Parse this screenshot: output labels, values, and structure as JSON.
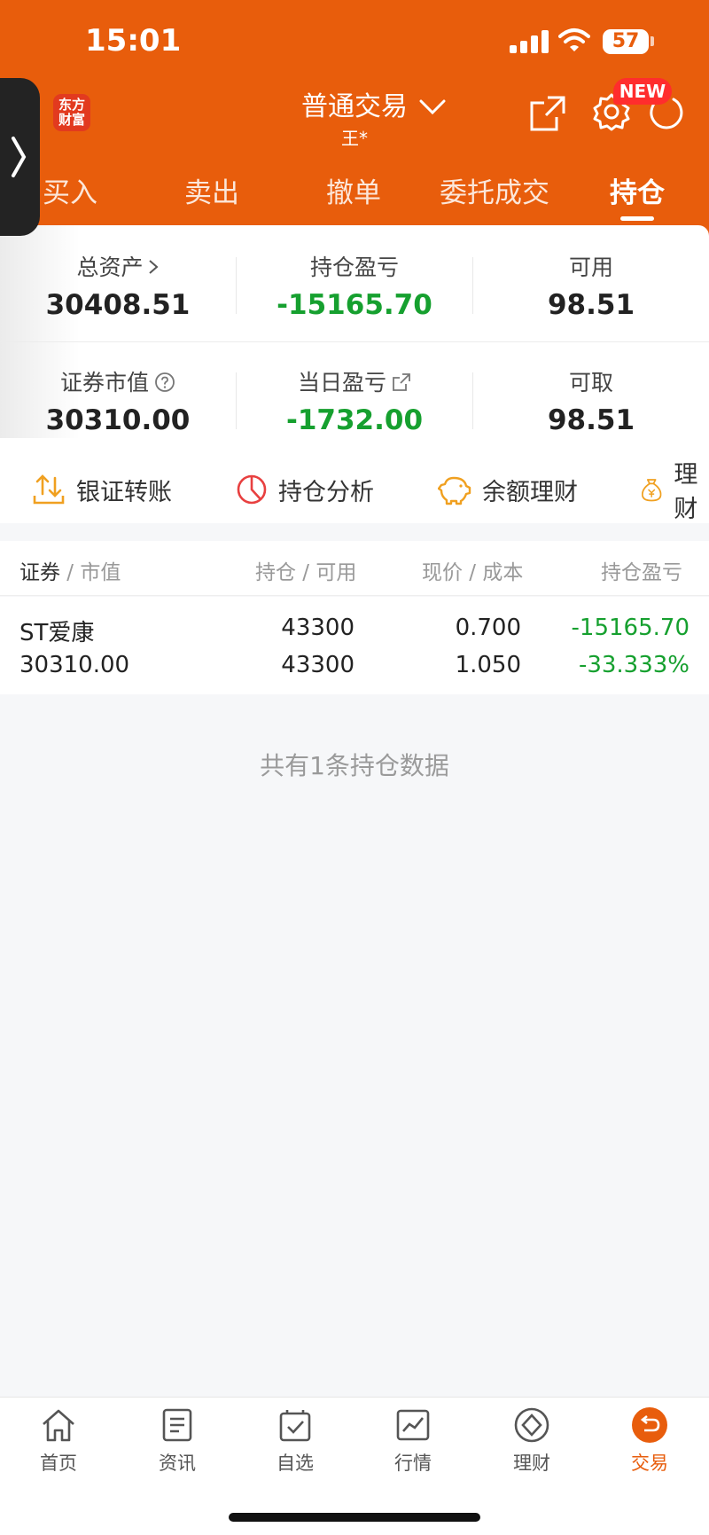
{
  "status_bar": {
    "time": "15:01",
    "battery": "57"
  },
  "header": {
    "logo_text": "东方财富",
    "title": "普通交易",
    "subtitle": "王*",
    "new_badge": "NEW",
    "brand_color": "#e85d0c"
  },
  "tabs": [
    {
      "label": "买入"
    },
    {
      "label": "卖出"
    },
    {
      "label": "撤单"
    },
    {
      "label": "委托成交"
    },
    {
      "label": "持仓",
      "active": true
    }
  ],
  "summary": {
    "total_assets_label": "总资产",
    "total_assets": "30408.51",
    "position_pl_label": "持仓盈亏",
    "position_pl": "-15165.70",
    "available_label": "可用",
    "available": "98.51",
    "market_value_label": "证券市值",
    "market_value": "30310.00",
    "daily_pl_label": "当日盈亏",
    "daily_pl": "-1732.00",
    "withdrawable_label": "可取",
    "withdrawable": "98.51"
  },
  "quick_actions": [
    {
      "label": "银证转账",
      "icon": "transfer-icon"
    },
    {
      "label": "持仓分析",
      "icon": "pie-chart-icon"
    },
    {
      "label": "余额理财",
      "icon": "piggy-bank-icon"
    },
    {
      "label": "理财",
      "icon": "money-bag-icon"
    }
  ],
  "table": {
    "headers": {
      "security": "证券",
      "market_value": "市值",
      "position": "持仓",
      "available": "可用",
      "price": "现价",
      "cost": "成本",
      "pl": "持仓盈亏"
    },
    "rows": [
      {
        "name": "ST爱康",
        "market_value": "30310.00",
        "position": "43300",
        "available": "43300",
        "price": "0.700",
        "cost": "1.050",
        "pl": "-15165.70",
        "pl_pct": "-33.333%"
      }
    ]
  },
  "footer_text": "共有1条持仓数据",
  "bottom_nav": [
    {
      "label": "首页",
      "icon": "home-icon"
    },
    {
      "label": "资讯",
      "icon": "news-icon"
    },
    {
      "label": "自选",
      "icon": "watchlist-icon"
    },
    {
      "label": "行情",
      "icon": "market-chart-icon"
    },
    {
      "label": "理财",
      "icon": "wealth-icon"
    },
    {
      "label": "交易",
      "icon": "trade-icon",
      "active": true
    }
  ],
  "colors": {
    "loss_green": "#16a02f",
    "accent": "#e85d0c"
  }
}
